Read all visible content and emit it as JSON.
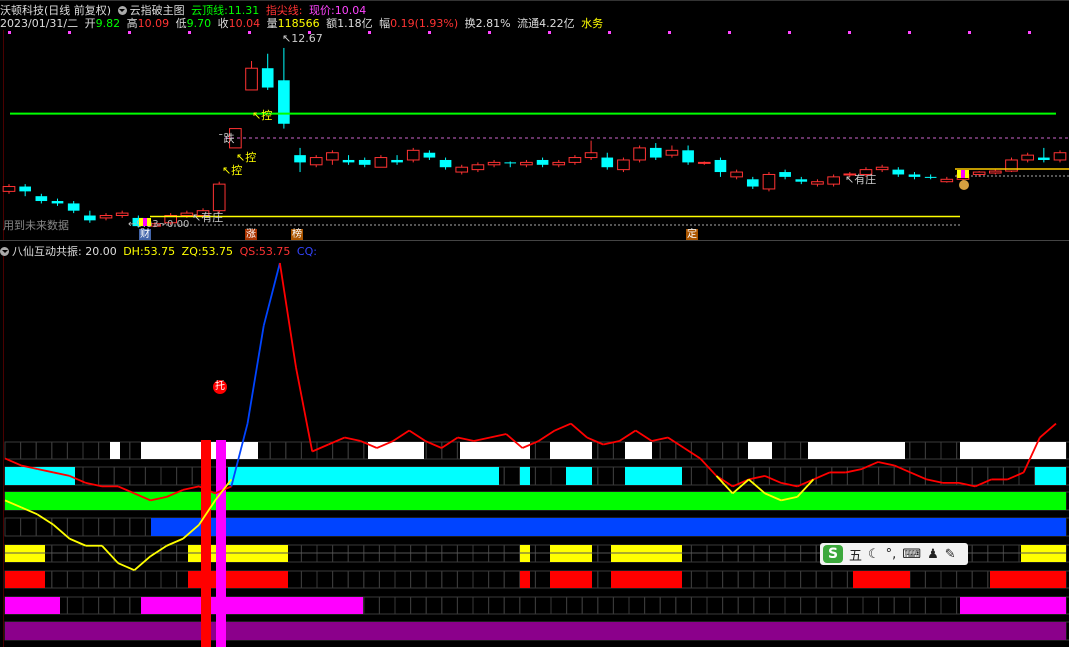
{
  "header": {
    "stock_name": "沃顿科技(日线 前复权)",
    "indicator_name": "云指破主图",
    "cloud_top_label": "云顶线:",
    "cloud_top_value": "11.31",
    "tip_line_label": "指尖线:",
    "now_price_label": "现价:",
    "now_price_value": "10.04"
  },
  "quote": {
    "date": "2023/01/31/二",
    "open_label": "开",
    "open": "9.82",
    "high_label": "高",
    "high": "10.09",
    "low_label": "低",
    "low": "9.70",
    "close_label": "收",
    "close": "10.04",
    "vol_label": "量",
    "vol": "118566",
    "amount_label": "额",
    "amount": "1.18亿",
    "change_label": "幅",
    "change": "0.19(1.93%)",
    "turnover_label": "换",
    "turnover": "2.81%",
    "float_label": "流通",
    "float": "4.22亿",
    "water_label": "水务"
  },
  "main_annotations": {
    "peak_price": "12.67",
    "future_data": "用到未来数据",
    "price_range": "9.03~0.00",
    "kong1": "控",
    "kong2": "控",
    "kong3": "控",
    "die": "跌",
    "youzhuang1": "有庄",
    "youzhuang2": "有庄",
    "cai": "财",
    "zhang": "涨",
    "bang": "榜",
    "ding": "定"
  },
  "sub_header": {
    "title": "八仙互动共振",
    "param": ": 20.00",
    "dh_label": "DH:",
    "dh": "53.75",
    "zq_label": "ZQ:",
    "zq": "53.75",
    "qs_label": "QS:",
    "qs": "53.75",
    "cq_label": "CQ:"
  },
  "sub_annotations": {
    "tuo": "托"
  },
  "ime_bar": {
    "logo": "S",
    "mode": "五"
  },
  "colors": {
    "up": "#ff3333",
    "down": "#00ffff",
    "ma_green": "#00ff00",
    "ma_yellow": "#ffff00",
    "curve_red": "#ff0000",
    "curve_blue": "#0044ff",
    "band_magenta": "#ff00ff",
    "band_purple": "#8b008b"
  },
  "chart_data": {
    "type": "candlestick",
    "price_ylim": [
      8.9,
      13.0
    ],
    "candles": [
      [
        9.7,
        9.8,
        9.85,
        9.65
      ],
      [
        9.8,
        9.7,
        9.85,
        9.6
      ],
      [
        9.6,
        9.5,
        9.65,
        9.45
      ],
      [
        9.5,
        9.45,
        9.55,
        9.4
      ],
      [
        9.45,
        9.3,
        9.5,
        9.25
      ],
      [
        9.2,
        9.1,
        9.3,
        9.05
      ],
      [
        9.15,
        9.2,
        9.25,
        9.1
      ],
      [
        9.2,
        9.25,
        9.3,
        9.15
      ],
      [
        9.15,
        8.98,
        9.2,
        8.95
      ],
      [
        8.98,
        9.03,
        9.05,
        8.96
      ],
      [
        9.05,
        9.2,
        9.25,
        9.0
      ],
      [
        9.2,
        9.25,
        9.3,
        9.15
      ],
      [
        9.2,
        9.3,
        9.35,
        9.15
      ],
      [
        9.3,
        9.85,
        9.9,
        9.25
      ],
      [
        10.6,
        11.0,
        11.0,
        10.6
      ],
      [
        11.8,
        12.25,
        12.4,
        11.8
      ],
      [
        12.25,
        11.85,
        12.55,
        11.8
      ],
      [
        12.0,
        11.1,
        12.67,
        11.0
      ],
      [
        10.45,
        10.3,
        10.6,
        10.1
      ],
      [
        10.25,
        10.4,
        10.45,
        10.2
      ],
      [
        10.35,
        10.5,
        10.55,
        10.25
      ],
      [
        10.35,
        10.3,
        10.45,
        10.25
      ],
      [
        10.35,
        10.25,
        10.4,
        10.2
      ],
      [
        10.2,
        10.4,
        10.45,
        10.2
      ],
      [
        10.35,
        10.3,
        10.45,
        10.25
      ],
      [
        10.35,
        10.55,
        10.6,
        10.3
      ],
      [
        10.5,
        10.4,
        10.55,
        10.35
      ],
      [
        10.35,
        10.2,
        10.4,
        10.15
      ],
      [
        10.1,
        10.2,
        10.25,
        10.05
      ],
      [
        10.15,
        10.25,
        10.3,
        10.1
      ],
      [
        10.25,
        10.3,
        10.35,
        10.2
      ],
      [
        10.3,
        10.28,
        10.32,
        10.2
      ],
      [
        10.25,
        10.3,
        10.35,
        10.2
      ],
      [
        10.35,
        10.25,
        10.4,
        10.2
      ],
      [
        10.25,
        10.3,
        10.35,
        10.2
      ],
      [
        10.3,
        10.4,
        10.45,
        10.25
      ],
      [
        10.4,
        10.5,
        10.75,
        10.35
      ],
      [
        10.4,
        10.2,
        10.5,
        10.15
      ],
      [
        10.15,
        10.35,
        10.4,
        10.1
      ],
      [
        10.35,
        10.6,
        10.65,
        10.3
      ],
      [
        10.6,
        10.4,
        10.7,
        10.35
      ],
      [
        10.45,
        10.55,
        10.65,
        10.4
      ],
      [
        10.55,
        10.3,
        10.65,
        10.25
      ],
      [
        10.28,
        10.3,
        10.32,
        10.25
      ],
      [
        10.35,
        10.1,
        10.4,
        10.0
      ],
      [
        10.0,
        10.1,
        10.15,
        9.95
      ],
      [
        9.95,
        9.8,
        10.0,
        9.75
      ],
      [
        9.75,
        10.05,
        10.1,
        9.7
      ],
      [
        10.1,
        10.0,
        10.15,
        9.95
      ],
      [
        9.95,
        9.9,
        10.0,
        9.85
      ],
      [
        9.85,
        9.9,
        9.95,
        9.8
      ],
      [
        9.85,
        10.0,
        10.05,
        9.8
      ],
      [
        10.05,
        10.06,
        10.1,
        10.0
      ],
      [
        10.05,
        10.15,
        10.2,
        10.0
      ],
      [
        10.15,
        10.2,
        10.25,
        10.1
      ],
      [
        10.15,
        10.05,
        10.2,
        10.0
      ],
      [
        10.05,
        10.0,
        10.1,
        9.95
      ],
      [
        10.0,
        9.98,
        10.05,
        9.95
      ],
      [
        9.9,
        9.95,
        10.0,
        9.88
      ],
      [
        9.95,
        10.05,
        10.1,
        9.9
      ],
      [
        10.05,
        10.1,
        10.12,
        10.0
      ],
      [
        10.08,
        10.12,
        10.15,
        10.05
      ],
      [
        10.12,
        10.35,
        10.4,
        10.1
      ],
      [
        10.35,
        10.45,
        10.5,
        10.3
      ],
      [
        10.4,
        10.35,
        10.6,
        10.3
      ],
      [
        10.35,
        10.5,
        10.55,
        10.3
      ]
    ],
    "ma_green": 11.31,
    "ma_yellow": 9.18,
    "osc_ylim": [
      0,
      110
    ],
    "osc_line": [
      52,
      50,
      49,
      48,
      47,
      45,
      44,
      44,
      42,
      40,
      41,
      43,
      44,
      42,
      44,
      62,
      90,
      108,
      78,
      54,
      56,
      58,
      57,
      55,
      57,
      60,
      57,
      55,
      58,
      57,
      58,
      59,
      55,
      57,
      60,
      62,
      58,
      56,
      57,
      60,
      57,
      58,
      55,
      52,
      47,
      44,
      46,
      47,
      45,
      44,
      46,
      48,
      48,
      49,
      51,
      50,
      48,
      46,
      45,
      45,
      44,
      46,
      46,
      48,
      58,
      62
    ],
    "yellow_line": [
      40,
      38,
      36,
      33,
      29,
      27,
      27,
      22,
      20,
      24,
      27,
      29,
      33,
      40,
      46,
      0,
      0,
      0,
      0,
      0,
      0,
      0,
      0,
      0,
      0,
      0,
      0,
      0,
      0,
      0,
      0,
      0,
      0,
      0,
      0,
      0,
      0,
      0,
      0,
      0,
      0,
      0,
      0,
      0,
      47,
      42,
      46,
      42,
      40,
      41,
      46,
      0,
      0,
      0,
      0,
      0,
      0,
      0,
      0,
      0,
      0,
      0,
      0,
      0,
      0,
      0
    ]
  }
}
